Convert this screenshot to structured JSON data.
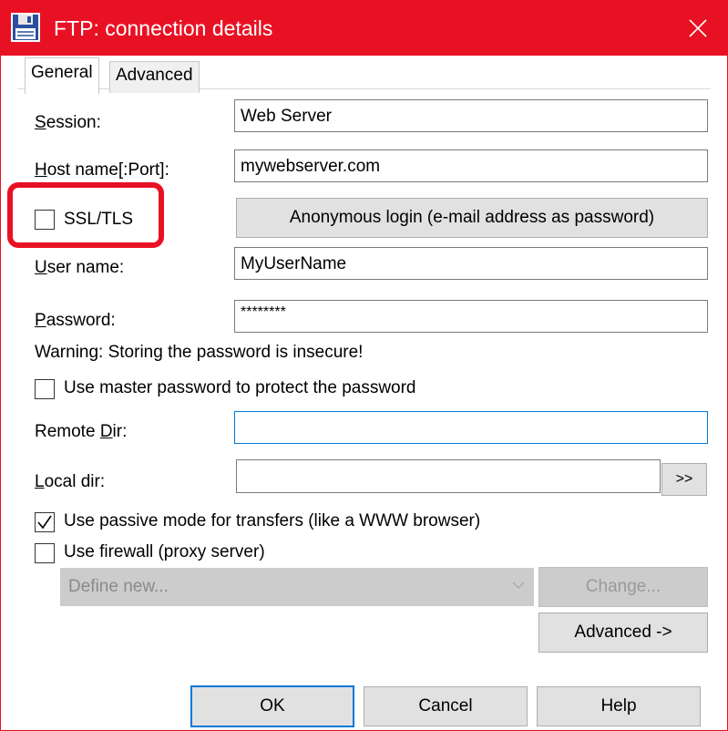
{
  "window": {
    "title": "FTP: connection details",
    "accent_color": "#e81123",
    "title_icon": "floppy-disk-icon",
    "close_icon": "close-icon"
  },
  "tabs": [
    {
      "label": "General",
      "active": true
    },
    {
      "label": "Advanced",
      "active": false
    }
  ],
  "form": {
    "session": {
      "label_u": "S",
      "label_rest": "ession:",
      "value": "Web Server"
    },
    "host": {
      "label_u": "H",
      "label_rest": "ost name[:Port]:",
      "value": "mywebserver.com"
    },
    "ssl": {
      "label": "SSL/TLS",
      "checked": false
    },
    "anonymous_button": "Anonymous login (e-mail address as password)",
    "username": {
      "label_u": "U",
      "label_rest": "ser name:",
      "value": "MyUserName"
    },
    "password": {
      "label_u": "P",
      "label_rest": "assword:",
      "value": "********"
    },
    "warning": "Warning: Storing the password is insecure!",
    "master_password": {
      "label": "Use master password to protect the password",
      "checked": false
    },
    "remote_dir": {
      "label_pre": "Remote ",
      "label_u": "D",
      "label_rest": "ir:",
      "value": ""
    },
    "local_dir": {
      "label_u": "L",
      "label_rest": "ocal dir:",
      "value": "",
      "browse_label": ">>"
    },
    "passive_mode": {
      "label": "Use passive mode for transfers (like a WWW browser)",
      "checked": true
    },
    "firewall": {
      "label": "Use firewall (proxy server)",
      "checked": false
    },
    "proxy_select": {
      "value": "Define new...",
      "icon": "chevron-down-icon"
    },
    "change_button": "Change...",
    "advanced_button": "Advanced ->"
  },
  "footer": {
    "ok": "OK",
    "cancel": "Cancel",
    "help": "Help"
  }
}
